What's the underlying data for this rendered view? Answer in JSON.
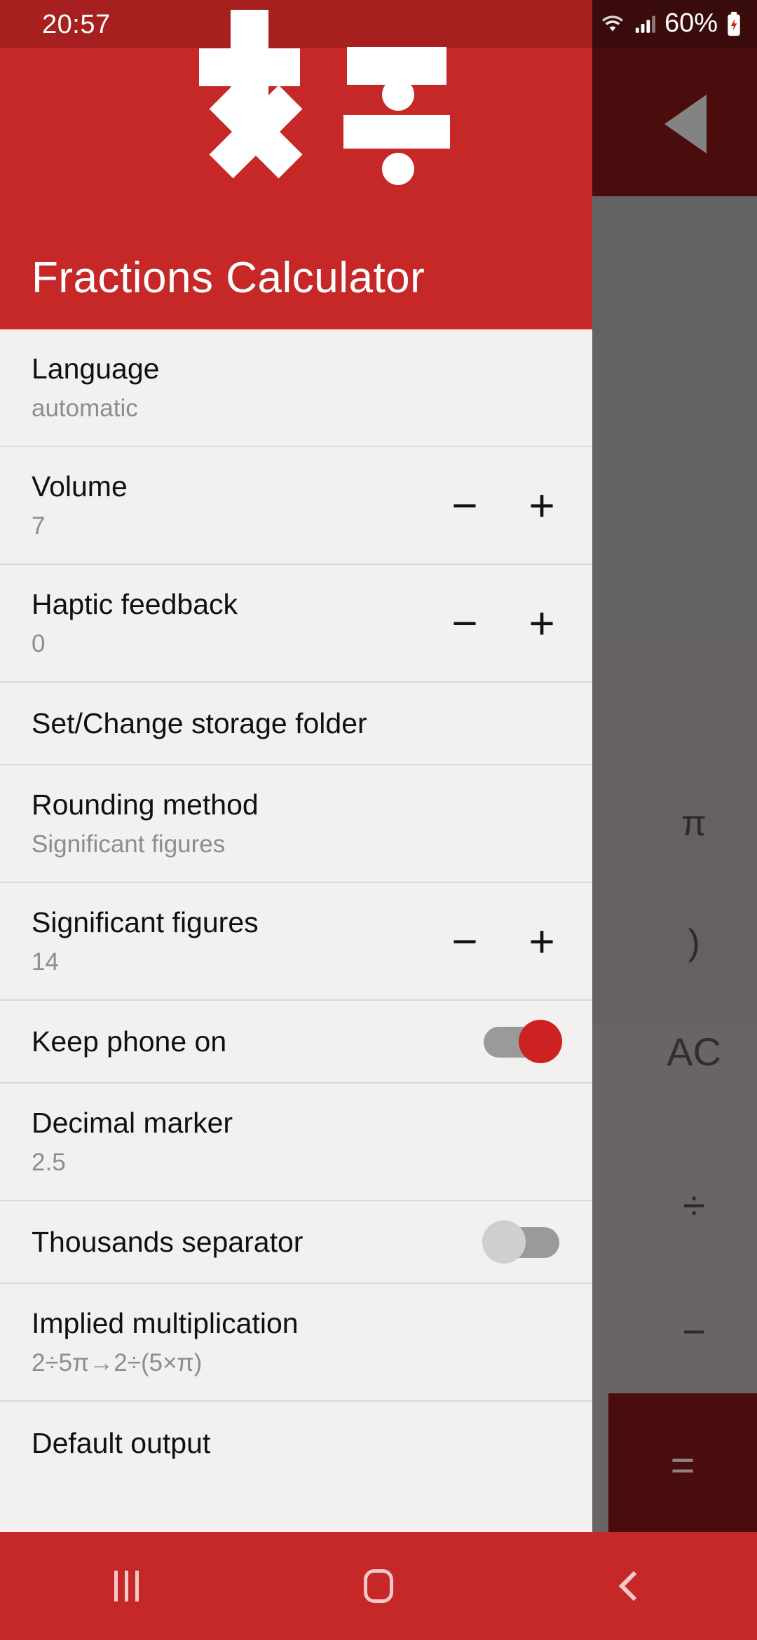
{
  "status_bar": {
    "time": "20:57",
    "battery_percent": "60%",
    "wifi_icon": "wifi-icon",
    "signal_icon": "cellular-signal-icon",
    "battery_icon": "battery-charging-icon"
  },
  "drawer": {
    "title": "Fractions Calculator",
    "logo_icons": [
      "plus-icon",
      "minus-icon",
      "multiply-icon",
      "divide-icon"
    ],
    "items": [
      {
        "title": "Language",
        "subtitle": "automatic",
        "control": "none"
      },
      {
        "title": "Volume",
        "subtitle": "7",
        "control": "stepper"
      },
      {
        "title": "Haptic feedback",
        "subtitle": "0",
        "control": "stepper"
      },
      {
        "title": "Set/Change storage folder",
        "subtitle": "",
        "control": "none"
      },
      {
        "title": "Rounding method",
        "subtitle": "Significant figures",
        "control": "none"
      },
      {
        "title": "Significant figures",
        "subtitle": "14",
        "control": "stepper"
      },
      {
        "title": "Keep phone on",
        "subtitle": "",
        "control": "switch_on"
      },
      {
        "title": "Decimal marker",
        "subtitle": "2.5",
        "control": "none"
      },
      {
        "title": "Thousands separator",
        "subtitle": "",
        "control": "switch_off"
      },
      {
        "title": "Implied multiplication",
        "subtitle": "2÷5π→2÷(5×π)",
        "control": "none"
      },
      {
        "title": "Default output",
        "subtitle": "",
        "control": "none"
      }
    ],
    "stepper": {
      "minus_label": "−",
      "plus_label": "+"
    }
  },
  "background_app": {
    "back_icon": "play-triangle-back-icon",
    "keys": {
      "pi": "π",
      "right_paren": ")",
      "all_clear": "AC",
      "divide": "÷",
      "minus": "−",
      "equals": "="
    }
  },
  "navigation_bar": {
    "recents_label": "recents-icon",
    "home_label": "home-icon",
    "back_label": "back-icon"
  },
  "colors": {
    "brand_red": "#c62828",
    "brand_red_dark": "#a62020",
    "toggle_on": "#cc2222",
    "surface": "#f2f1f0",
    "scrim": "#6b6464"
  }
}
